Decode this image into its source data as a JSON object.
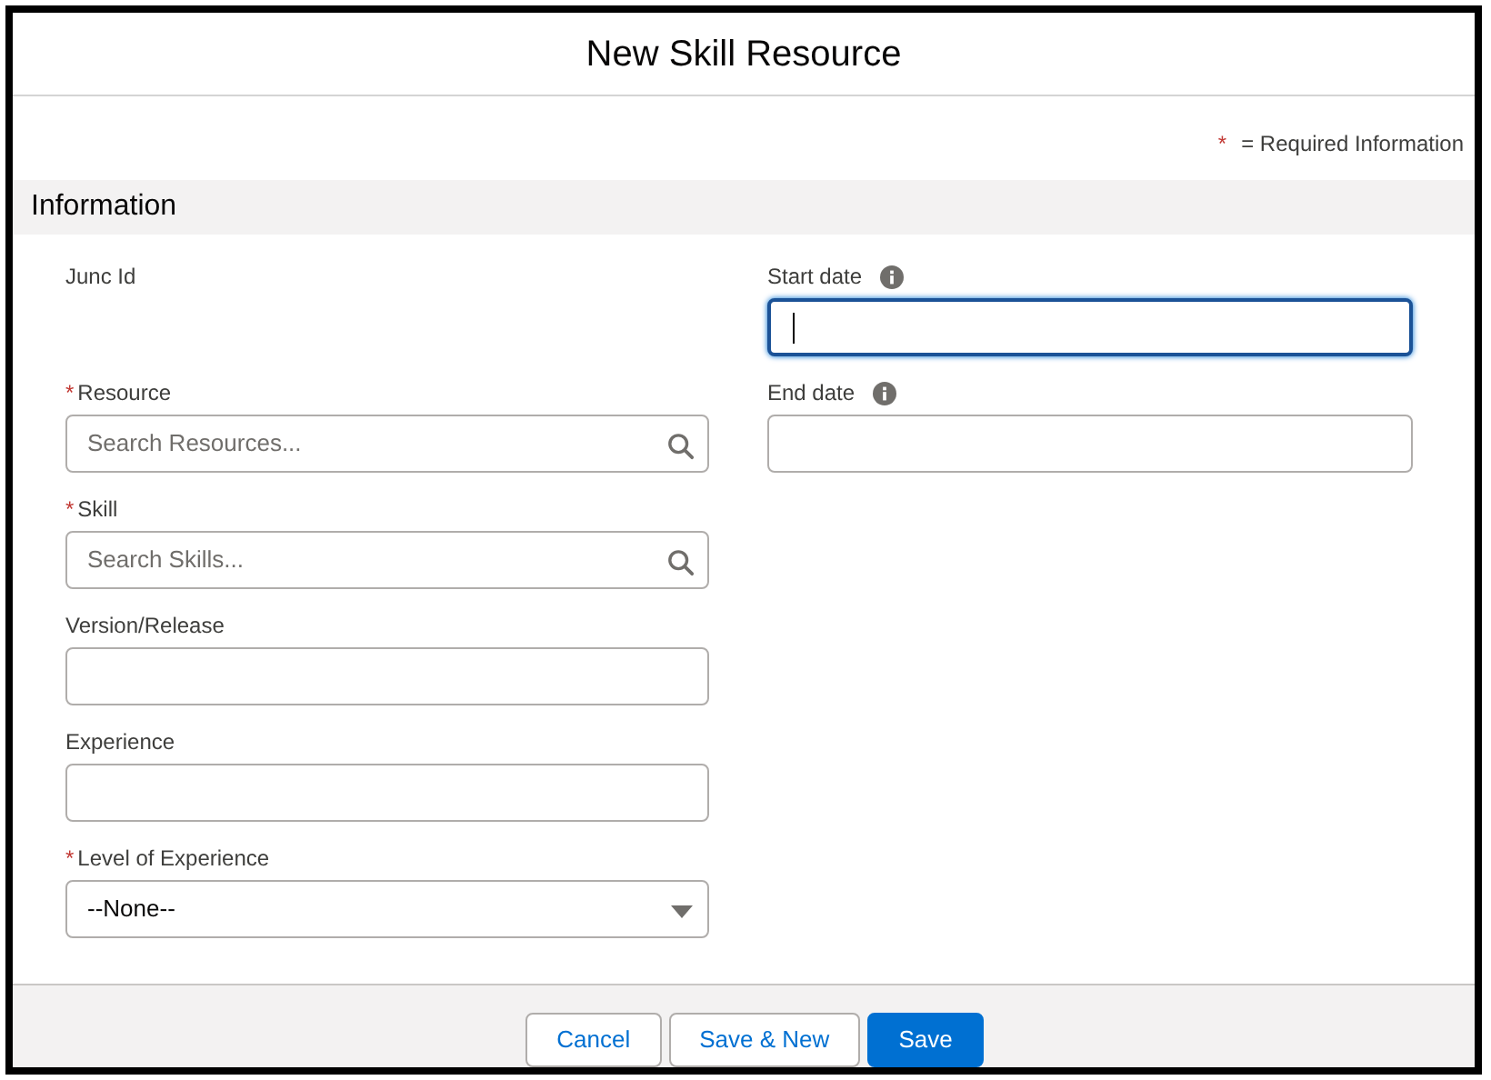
{
  "dialog": {
    "title": "New Skill Resource",
    "required_note": {
      "mark": "*",
      "text": "= Required Information"
    },
    "section": {
      "title": "Information"
    },
    "left_fields": [
      {
        "label": "Junc Id",
        "kind": "readonly"
      },
      {
        "label": "Resource",
        "kind": "lookup",
        "required_mark": "*",
        "placeholder": "Search Resources..."
      },
      {
        "label": "Skill",
        "kind": "lookup",
        "required_mark": "*",
        "placeholder": "Search Skills..."
      },
      {
        "label": "Version/Release",
        "kind": "input"
      },
      {
        "label": "Experience",
        "kind": "input"
      },
      {
        "label": "Level of Experience",
        "kind": "picklist",
        "required_mark": "*",
        "value": "--None--"
      }
    ],
    "right_fields": [
      {
        "label": "Start date",
        "kind": "date",
        "info": true,
        "focused": true
      },
      {
        "label": "End date",
        "kind": "date",
        "info": true,
        "focused": false
      }
    ],
    "buttons": [
      {
        "label": "Cancel",
        "kind": "neutral"
      },
      {
        "label": "Save & New",
        "kind": "neutral"
      },
      {
        "label": "Save",
        "kind": "brand"
      }
    ]
  }
}
